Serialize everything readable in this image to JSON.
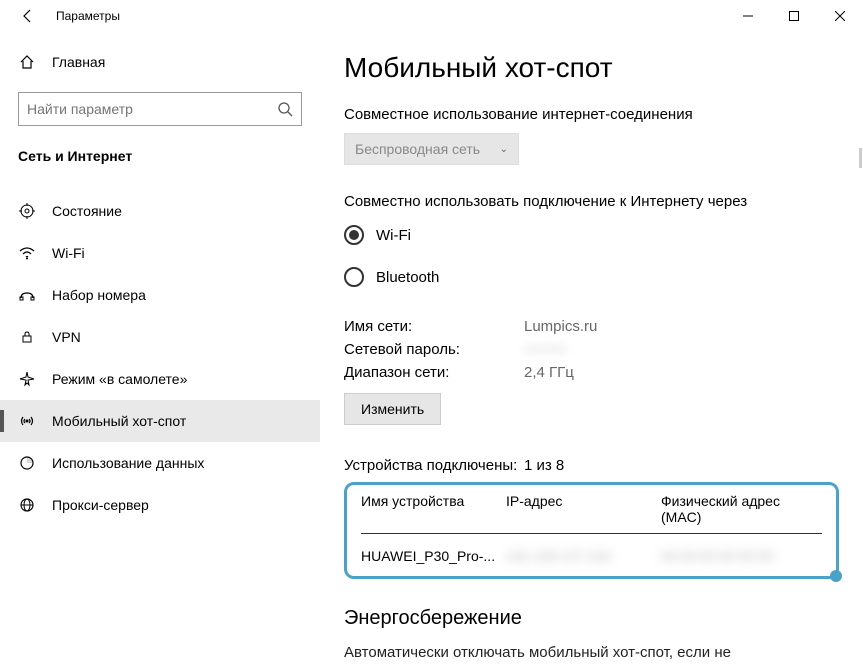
{
  "titlebar": {
    "title": "Параметры"
  },
  "sidebar": {
    "home": "Главная",
    "search_placeholder": "Найти параметр",
    "category": "Сеть и Интернет",
    "items": [
      {
        "label": "Состояние"
      },
      {
        "label": "Wi-Fi"
      },
      {
        "label": "Набор номера"
      },
      {
        "label": "VPN"
      },
      {
        "label": "Режим «в самолете»"
      },
      {
        "label": "Мобильный хот-спот"
      },
      {
        "label": "Использование данных"
      },
      {
        "label": "Прокси-сервер"
      }
    ]
  },
  "main": {
    "title": "Мобильный хот-спот",
    "share_label": "Совместное использование интернет-соединения",
    "share_dropdown": "Беспроводная сеть",
    "share_via_label": "Совместно использовать подключение к Интернету через",
    "radio_wifi": "Wi-Fi",
    "radio_bt": "Bluetooth",
    "net_name_k": "Имя сети:",
    "net_name_v": "Lumpics.ru",
    "net_pass_k": "Сетевой пароль:",
    "net_pass_v": "••••••••",
    "net_band_k": "Диапазон сети:",
    "net_band_v": "2,4 ГГц",
    "change_btn": "Изменить",
    "devices_k": "Устройства подключены:",
    "devices_v": "1 из 8",
    "tbl_col1": "Имя устройства",
    "tbl_col2": "IP-адрес",
    "tbl_col3": "Физический адрес (MAC)",
    "row1_name": "HUAWEI_P30_Pro-...",
    "row1_ip": "192.168.137.244",
    "row1_mac": "00:00:00:00:00:00",
    "h2": "Энергосбережение",
    "trunc": "Автоматически отключать мобильный хот-спот, если не"
  }
}
